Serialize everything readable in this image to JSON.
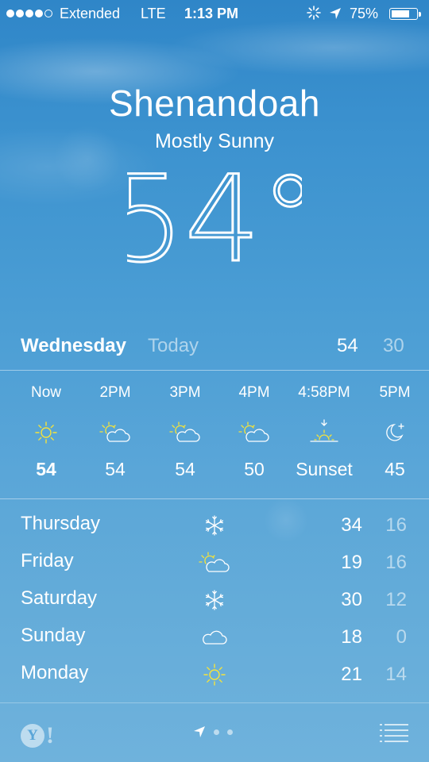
{
  "status_bar": {
    "carrier": "Extended",
    "network": "LTE",
    "time": "1:13 PM",
    "battery_percent": "75%",
    "battery_level": 0.75,
    "signal_bars": 4
  },
  "header": {
    "city": "Shenandoah",
    "condition": "Mostly Sunny",
    "temperature": "54°"
  },
  "today": {
    "day": "Wednesday",
    "label": "Today",
    "high": "54",
    "low": "30"
  },
  "hourly": [
    {
      "time": "Now",
      "icon": "sun-icon",
      "value": "54"
    },
    {
      "time": "2PM",
      "icon": "partly-cloudy-icon",
      "value": "54"
    },
    {
      "time": "3PM",
      "icon": "partly-cloudy-icon",
      "value": "54"
    },
    {
      "time": "4PM",
      "icon": "partly-cloudy-icon",
      "value": "50"
    },
    {
      "time": "4:58PM",
      "icon": "sunset-icon",
      "value": "Sunset"
    },
    {
      "time": "5PM",
      "icon": "moon-icon",
      "value": "45"
    }
  ],
  "daily": [
    {
      "day": "Thursday",
      "icon": "snow-icon",
      "high": "34",
      "low": "16"
    },
    {
      "day": "Friday",
      "icon": "partly-cloudy-icon",
      "high": "19",
      "low": "16"
    },
    {
      "day": "Saturday",
      "icon": "snow-icon",
      "high": "30",
      "low": "12"
    },
    {
      "day": "Sunday",
      "icon": "cloud-icon",
      "high": "18",
      "low": "0"
    },
    {
      "day": "Monday",
      "icon": "sun-icon",
      "high": "21",
      "low": "14"
    }
  ],
  "colors": {
    "sun_yellow": "#f5e33a",
    "background_top": "#2f86c8",
    "background_bottom": "#6fb2dc"
  },
  "bottom_bar": {
    "logo_text": "Y",
    "logo_bang": "!"
  }
}
